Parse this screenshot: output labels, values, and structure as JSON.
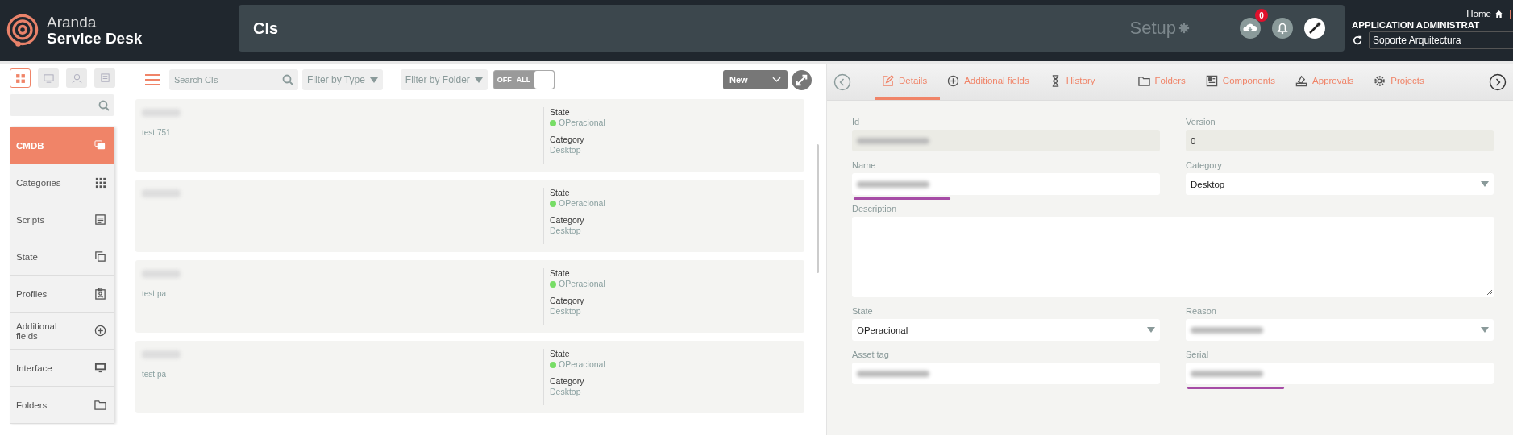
{
  "header": {
    "brand_top": "Aranda",
    "brand_bottom": "Service Desk",
    "page_title": "CIs",
    "setup": "Setup",
    "notification_count": "0",
    "home": "Home",
    "separator": "|",
    "user_role": "APPLICATION ADMINISTRAT",
    "group": "Soporte Arquitectura"
  },
  "sidebar": {
    "views": [
      {
        "selected": true
      },
      {
        "selected": false
      },
      {
        "selected": false
      },
      {
        "selected": false
      }
    ],
    "items": [
      {
        "label": "CMDB",
        "selected": true
      },
      {
        "label": "Categories",
        "selected": false
      },
      {
        "label": "Scripts",
        "selected": false
      },
      {
        "label": "State",
        "selected": false
      },
      {
        "label": "Profiles",
        "selected": false
      },
      {
        "label": "Additional fields",
        "selected": false
      },
      {
        "label": "Interface",
        "selected": false
      },
      {
        "label": "Folders",
        "selected": false
      }
    ]
  },
  "list": {
    "search": {
      "placeholder": "Search CIs"
    },
    "filter_type": "Filter by Type",
    "filter_folder": "Filter by Folder",
    "toggle": {
      "off_label": "OFF",
      "on_label": "ALL",
      "on": true
    },
    "new_button": "New",
    "cards": [
      {
        "subtitle": "test 751",
        "state_label": "State",
        "state": "OPeracional",
        "category_label": "Category",
        "category": "Desktop"
      },
      {
        "state_label": "State",
        "state": "OPeracional",
        "category_label": "Category",
        "category": "Desktop"
      },
      {
        "subtitle": "test pa",
        "state_label": "State",
        "state": "OPeracional",
        "category_label": "Category",
        "category": "Desktop"
      },
      {
        "subtitle": "test pa",
        "state_label": "State",
        "state": "OPeracional",
        "category_label": "Category",
        "category": "Desktop"
      }
    ]
  },
  "detail": {
    "tabs": [
      {
        "label": "Details",
        "selected": true
      },
      {
        "label": "Additional fields",
        "selected": false
      },
      {
        "label": "History",
        "selected": false
      },
      {
        "label": "Folders",
        "selected": false
      },
      {
        "label": "Components",
        "selected": false
      },
      {
        "label": "Approvals",
        "selected": false
      },
      {
        "label": "Projects",
        "selected": false
      }
    ],
    "fields": [
      {
        "label": "Id",
        "kind": "readonly",
        "blurred": true
      },
      {
        "label": "Version",
        "kind": "readonly",
        "value": "0"
      },
      {
        "label": "Name",
        "kind": "text",
        "blurred": true,
        "underlined": true
      },
      {
        "label": "Category",
        "kind": "select",
        "value": "Desktop"
      },
      {
        "label": "Description",
        "kind": "textarea"
      },
      {
        "label": "State",
        "kind": "select",
        "value": "OPeracional"
      },
      {
        "label": "Reason",
        "kind": "select",
        "blurred": true
      },
      {
        "label": "Asset tag",
        "kind": "text",
        "blurred": true
      },
      {
        "label": "Serial",
        "kind": "text",
        "blurred": true,
        "underlined": true
      }
    ]
  }
}
